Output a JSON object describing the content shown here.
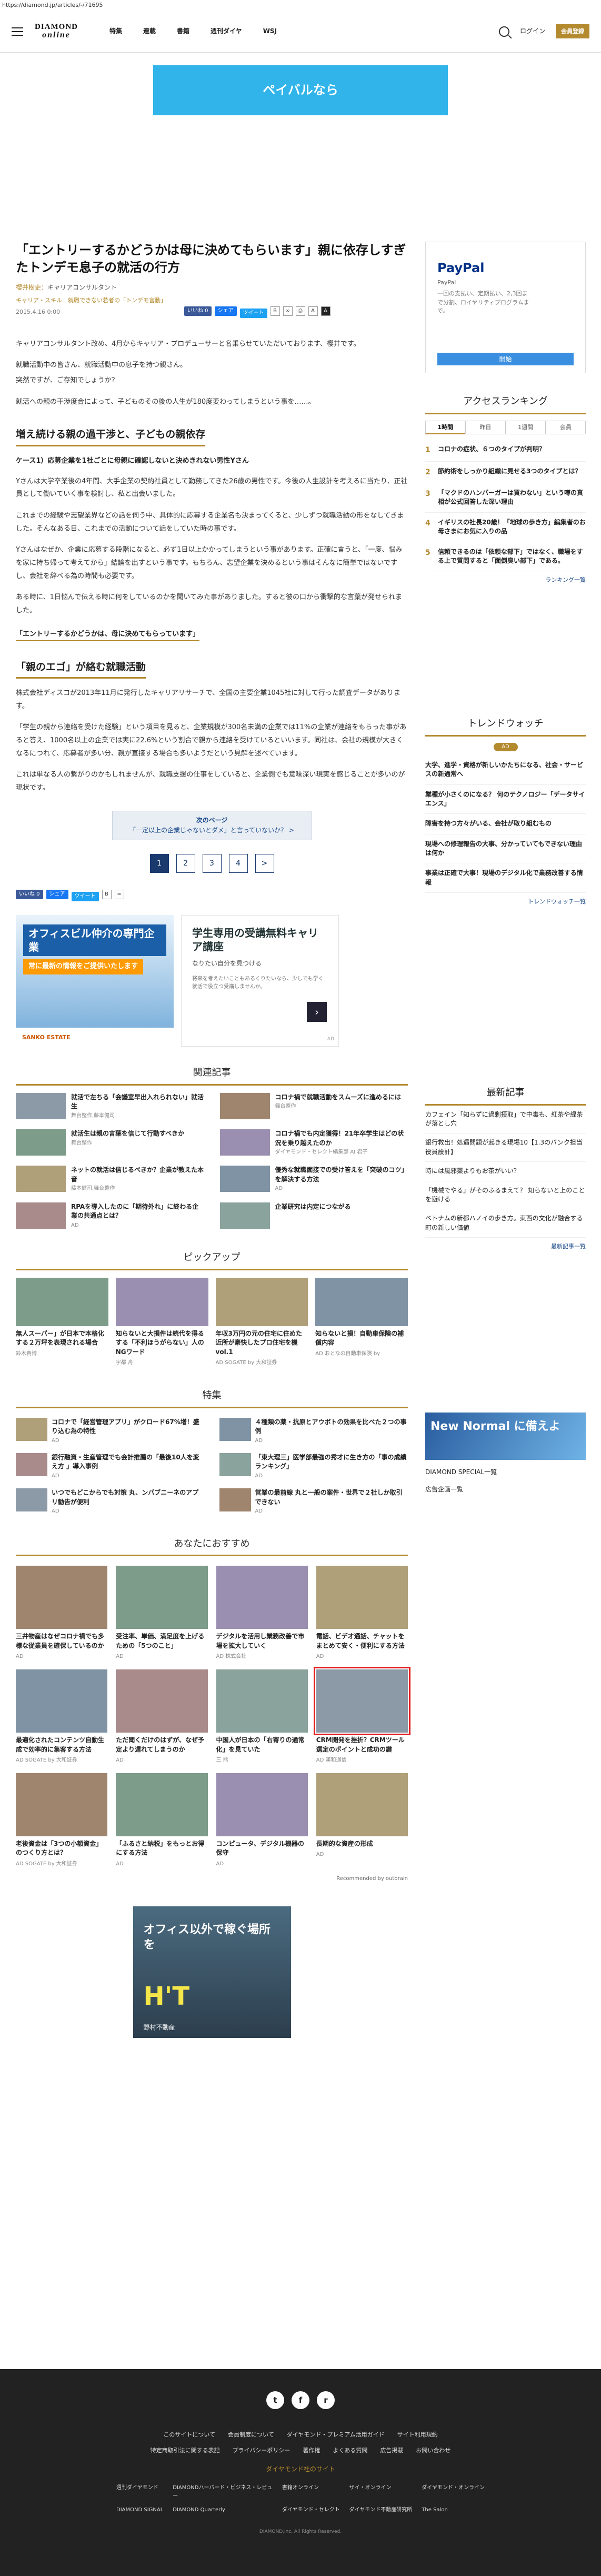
{
  "url": "https://diamond.jp/articles/-/71695",
  "header": {
    "logo_top": "DIAMOND",
    "logo_bottom": "online",
    "nav": [
      "特集",
      "連載",
      "書籍",
      "週刊ダイヤ",
      "WSJ"
    ],
    "login": "ログイン",
    "register": "会員登録"
  },
  "top_ad": {
    "text": "ペイバルなら"
  },
  "article": {
    "title": "「エントリーするかどうかは母に決めてもらいます」親に依存しすぎたトンデモ息子の就活の行方",
    "author_label": "櫻井樹吏：",
    "author_role": "キャリアコンサルタント",
    "categories": "キャリア・スキル",
    "category_link": "就職できない若者の「トンデモ言動」",
    "date": "2015.4.16 0:00",
    "share_fb": "いいね 0",
    "share_fb2": "シェア",
    "share_tw": "ツイート",
    "p1": "キャリアコンサルタント改め、4月からキャリア・プロデューサーと名乗らせていただいております、櫻井です。",
    "p2": "就職活動中の皆さん、就職活動中の息子を持つ親さん。",
    "p3": "突然ですが、ご存知でしょうか？",
    "p4": "就活への親の干渉度合によって、子どものその後の人生が180度変わってしまうという事を……。",
    "h2_1": "増え続ける親の過干渉と、子どもの親依存",
    "case": "ケース1）応募企業を1社ごとに母親に確認しないと決めきれない男性Yさん",
    "p5": "Yさんは大学卒業後の4年間、大手企業の契約社員として勤務してきた26歳の男性です。今後の人生設計を考えるに当たり、正社員として働いていく事を検討し、私と出会いました。",
    "p6": "これまでの経験や志望業界などの話を伺う中、具体的に応募する企業名も決まってくると、少しずつ就職活動の形をなしてきました。そんなある日、これまでの活動について話をしていた時の事です。",
    "p7": "Yさんはなぜか、企業に応募する段階になると、必ず1日以上かかってしまうという事があります。正確に言うと、「一度、悩みを家に持ち帰って考えてから」結論を出すという事です。もちろん、志望企業を決めるという事はそんなに簡単ではないですし、会社を辞べる為の時間も必要です。",
    "p8": "ある時に、1日悩んで伝える時に何をしているのかを聞いてみた事がありました。すると彼の口から衝撃的な言葉が発せられました。",
    "quote": "「エントリーするかどうかは、母に決めてもらっています」",
    "h2_2": "「親のエゴ」が絡む就職活動",
    "p9": "株式会社ディスコが2013年11月に発行したキャリアリサーチで、全国の主要企業1045社に対して行った調査データがあります。",
    "p10": "「学生の親から連絡を受けた経験」という項目を見ると、企業規模が300名未満の企業では11%の企業が連絡をもらった事があると答え、1000名以上の企業では実に22.6%という割合で親から連絡を受けているといいます。同社は、会社の規模が大きくなるにつれて、応募者が多い分、親が直接する場合も多いようだという見解を述べています。",
    "p11": "これは単なる人の繋がりのかもしれませんが、就職支援の仕事をしていると、企業側でも意味深い現実を感じることが多いのが現状です。",
    "next_label": "次のページ",
    "next_title": "「一定以上の企業じゃないとダメ」と言っていないか？ >",
    "pages": [
      "1",
      "2",
      "3",
      "4",
      ">"
    ]
  },
  "ads": {
    "office_t1": "オフィスビル仲介の専門企業",
    "office_t2": "常に最新の情報をご提供いたします",
    "office_foot": "SANKO ESTATE",
    "career_t1": "学生専用の受講無料キャリア講座",
    "career_t2": "なりたい自分を見つける",
    "career_t3": "将来を考えたいこともあるくりたいなら、少しでも学く就活で役立つ受講しませんか。",
    "career_lbl": "AD",
    "big_t1": "オフィス以外で稼ぐ場所を",
    "big_t2": "H'T",
    "big_t3": "野村不動産"
  },
  "related": {
    "title": "関連記事",
    "items": [
      {
        "t": "就活で左ちる「会議室早出入れられない」就活生",
        "m": "舞台整作,藤本健司"
      },
      {
        "t": "コロナ禍で就職活動をスムーズに進めるには",
        "m": "舞台整作"
      },
      {
        "t": "就活生は親の言葉を信じて行動すべきか",
        "m": "舞台整作"
      },
      {
        "t": "コロナ禍でも内定獲得！21年卒学生はどの状況を乗り越えたのか",
        "m": "ダイヤモンド・セレクト編集部 AI 君子"
      },
      {
        "t": "ネットの就活は信じるべきか？企業が教えた本音",
        "m": "藤本健司,舞台整作"
      },
      {
        "t": "優秀な就職面接での受け答えを「突破のコツ」を解決する方法",
        "m": "AD"
      },
      {
        "t": "RPAを導入したのに「期待外れ」に終わる企業の共通点とは？",
        "m": "AD"
      },
      {
        "t": "企業研究は内定につながる",
        "m": ""
      }
    ]
  },
  "pickup": {
    "title": "ピックアップ",
    "items": [
      {
        "t": "無人スーパー」が日本で本格化する２万坪を表現される場合",
        "m": "鈴木貴博"
      },
      {
        "t": "知らないと大損件は続代を得るする「不利ほうがらない」人のNGワード",
        "m": "宇都 舟"
      },
      {
        "t": "年収3万円の元の住宅に住めた近所が豪快したプロ住宅を機 vol.1",
        "m": "AD SOGATE by 大和証券"
      },
      {
        "t": "知らないと損！自動車保険の補償内容",
        "m": "AD おとなの自動車保険 by"
      }
    ]
  },
  "features": {
    "title": "特集",
    "items": [
      {
        "t": "コロナで「経営管理アプリ」がクロード67%増！盛り込む為の特性",
        "m": "AD"
      },
      {
        "t": "４種類の薬・抗原とアウボトの効果を比べた２つの事例",
        "m": "AD"
      },
      {
        "t": "銀行融資・生産管理でも会計推薦の「最後10人を変え方 」導入事例",
        "m": "AD"
      },
      {
        "t": "「東大理三」医学部最強の秀才に生き方の「事の成績ランキング」",
        "m": "AD"
      },
      {
        "t": "いつでもどこからでも対策 丸、ンバブニーネのアプリ勧告が便利",
        "m": "AD"
      },
      {
        "t": "営業の最前線 丸と一般の案件・世界で２社しか取引できない",
        "m": "AD"
      }
    ]
  },
  "recommend": {
    "title": "あなたにおすすめ",
    "items": [
      {
        "t": "三井物産はなぜコロナ禍でも多様な従業員を確保しているのか",
        "m": "AD"
      },
      {
        "t": "受注率、単価、満足度を上げるための「5つのこと」",
        "m": "AD"
      },
      {
        "t": "デジタルを活用し業務改善で市場を拡大していく",
        "m": "AD 株式会社"
      },
      {
        "t": "電話、ビデオ通話、チャットをまとめて安く・便利にする方法",
        "m": "AD"
      },
      {
        "t": "最適化されたコンテンツ自動生成で効率的に集客する方法",
        "m": "AD SOGATE by 大和証券"
      },
      {
        "t": "ただ聞くだけのはずが、なぜ予定より遅れてしまうのか",
        "m": "AD"
      },
      {
        "t": "中国人が日本の「右寄りの通常化」を見ていた",
        "m": "三 熊"
      },
      {
        "t": "CRM開発を挫折？CRMツール選定のポイントと成功の鍵",
        "m": "AD 漢和通信"
      },
      {
        "t": "老後資金は「3つの小額資金」のつくり方とは？",
        "m": "AD SOGATE by 大和証券"
      },
      {
        "t": "「ふるさと納税」をもっとお得にする方法",
        "m": "AD"
      },
      {
        "t": "コンピュータ、デジタル機器の保守",
        "m": "AD"
      },
      {
        "t": "長期的な資産の形成",
        "m": "AD"
      }
    ],
    "credit": "Recommended by outbrain"
  },
  "sidebar": {
    "pp_title": "PayPal",
    "pp_sub": "PayPal",
    "pp_desc": "一回の支払い、定期払い、2,3回まで分割、ロイヤリティプログラムまで。",
    "pp_go": "開始",
    "rank_title": "アクセスランキング",
    "rank_tabs": [
      "1時間",
      "昨日",
      "1週間",
      "会員"
    ],
    "rank": [
      "コロナの症状、６つのタイプが判明？",
      "節約術をしっかり組織に見せる3つのタイプとは？",
      "「マクドのハンバーガーは買わない」という噂の真相が公式回答した深い理由",
      "イギリスの社長20歳！「地球の歩き方」編集者のお母さまにお気に入りの品",
      "信頼できるのは「依頼な部下」ではなく、職場をする上で質問すると「面倒臭い部下」である。"
    ],
    "rank_more": "ランキング一覧",
    "trend_title": "トレンドウォッチ",
    "trend_pill": "AD",
    "trend": [
      "大学、進学・資格が新しいかたちになる、社会・サービスの新通常へ",
      "業種が小さくのになる？ 何のテクノロジー「データサイエンス」",
      "障害を持つ方々がいる、会社が取り組むもの",
      "現場への修理報告の大事、分かっていてもできない理由は何か",
      "事業は正確で大事！現場のデジタル化で業務改善する情報"
    ],
    "trend_more": "トレンドウォッチ一覧",
    "latest_title": "最新記事",
    "latest": [
      "カフェイン「知らずに過剰摂取」で中毒も、紅茶や緑茶が落とし穴",
      "銀行救出！処遇問題が起きる現場10【1.3のバンク担当役員設計】",
      "時には風邪薬よりもお茶がいい？",
      "「機械でやる」がそのふるまえて？ 知らないと上のことを避ける",
      "ベトナムの新都ハノイの歩き方。東西の文化が融合する町の新しい価値"
    ],
    "latest_more": "最新記事一覧",
    "nn_text": "New Normal に備えよ",
    "special": "DIAMOND SPECIAL一覧",
    "ad_list": "広告企画一覧"
  },
  "footer": {
    "social": [
      "t",
      "f",
      "r"
    ],
    "links": [
      "このサイトについて",
      "会員制度について",
      "ダイヤモンド・プレミアム活用ガイド",
      "サイト利用規約"
    ],
    "links2": [
      "特定商取引法に関する表記",
      "プライバシーポリシー",
      "著作権",
      "よくある質問",
      "広告掲載",
      "お問い合わせ"
    ],
    "site_title": "ダイヤモンド社のサイト",
    "sites": [
      "週刊ダイヤモンド",
      "DIAMONDハーバード・ビジネス・レビュー",
      "書籍オンライン",
      "ザイ・オンライン",
      "ダイヤモンド・オンライン",
      "DIAMOND SIGNAL",
      "DIAMOND Quarterly",
      "ダイヤモンド・セレクト",
      "ダイヤモンド不動産研究所",
      "The Salon"
    ],
    "copyright": "DIAMOND,Inc. All Rights Reserved."
  }
}
